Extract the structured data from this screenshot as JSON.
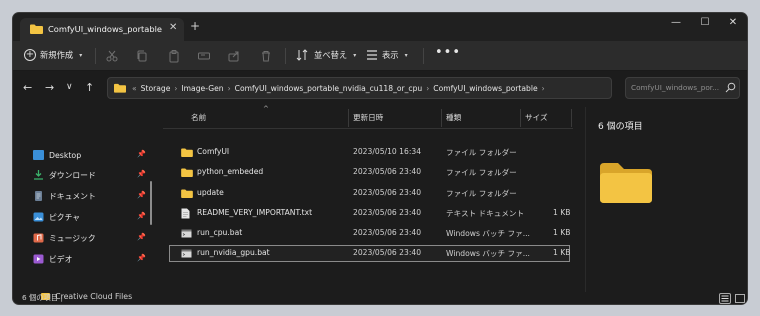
{
  "window": {
    "tab_title": "ComfyUI_windows_portable",
    "tab_close": "✕",
    "new_tab": "+",
    "controls": {
      "minimize": "—",
      "maximize": "☐",
      "close": "✕"
    }
  },
  "commandbar": {
    "new_label": "新規作成",
    "sort_label": "並べ替え",
    "view_label": "表示",
    "more": "•••",
    "caret": "▾"
  },
  "nav": {
    "back": "←",
    "forward": "→",
    "history": "∨",
    "up": "↑",
    "refresh": "↻",
    "breadcrumb": [
      "«",
      "Storage",
      "Image-Gen",
      "ComfyUI_windows_portable_nvidia_cu118_or_cpu",
      "ComfyUI_windows_portable"
    ],
    "breadcrumb_sep": "›",
    "search_placeholder": "ComfyUI_windows_por..."
  },
  "sidebar": {
    "items": [
      {
        "label": "Desktop",
        "icon": "desktop-icon",
        "color": "#3a8fd8"
      },
      {
        "label": "ダウンロード",
        "icon": "download-icon",
        "color": "#3bb36b"
      },
      {
        "label": "ドキュメント",
        "icon": "documents-icon",
        "color": "#6b7e95"
      },
      {
        "label": "ピクチャ",
        "icon": "pictures-icon",
        "color": "#3a8fd8"
      },
      {
        "label": "ミュージック",
        "icon": "music-icon",
        "color": "#e06a4a"
      },
      {
        "label": "ビデオ",
        "icon": "videos-icon",
        "color": "#9b5ad1"
      }
    ],
    "pin": "📌",
    "bottom_item": "Creative Cloud Files"
  },
  "filelist": {
    "columns": [
      "名前",
      "更新日時",
      "種類",
      "サイズ"
    ],
    "sort_indicator": "^",
    "rows": [
      {
        "name": "ComfyUI",
        "date": "2023/05/10 16:34",
        "type": "ファイル フォルダー",
        "size": "",
        "icon": "folder-icon"
      },
      {
        "name": "python_embeded",
        "date": "2023/05/06 23:40",
        "type": "ファイル フォルダー",
        "size": "",
        "icon": "folder-icon"
      },
      {
        "name": "update",
        "date": "2023/05/06 23:40",
        "type": "ファイル フォルダー",
        "size": "",
        "icon": "folder-icon"
      },
      {
        "name": "README_VERY_IMPORTANT.txt",
        "date": "2023/05/06 23:40",
        "type": "テキスト ドキュメント",
        "size": "1 KB",
        "icon": "text-file-icon"
      },
      {
        "name": "run_cpu.bat",
        "date": "2023/05/06 23:40",
        "type": "Windows バッチ ファ...",
        "size": "1 KB",
        "icon": "batch-file-icon"
      },
      {
        "name": "run_nvidia_gpu.bat",
        "date": "2023/05/06 23:40",
        "type": "Windows バッチ ファ...",
        "size": "1 KB",
        "icon": "batch-file-icon"
      }
    ]
  },
  "preview": {
    "title": "6 個の項目"
  },
  "status": {
    "text": "6 個の項目  |"
  },
  "colors": {
    "folder": "#f3c443",
    "folder_dark": "#d9a52a",
    "accent": "#4aa3df"
  }
}
